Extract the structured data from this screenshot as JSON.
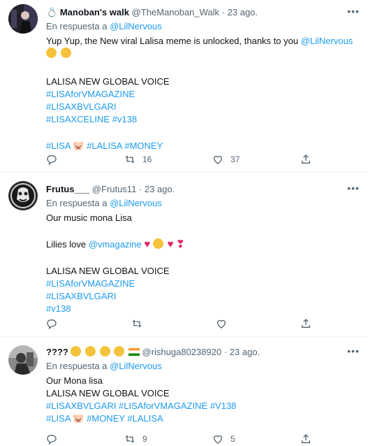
{
  "tweets": [
    {
      "name": "Manoban's walk",
      "handle": "@TheManoban_Walk",
      "time": "23 ago.",
      "reply_prefix": "En respuesta a",
      "reply_to": "@LilNervous",
      "text_main": "Yup Yup,  the New viral Lalisa meme is unlocked, thanks to you ",
      "text_mention": "@LilNervous",
      "line_voice": "LALISA NEW GLOBAL VOICE",
      "tags1": "#LISAforVMAGAZINE",
      "tags2": "#LISAXBVLGARI",
      "tags3": "#LISAXCELINE #v138",
      "tag_lisa": "#LISA",
      "tags_rest": "#LALISA #MONEY",
      "retweets": "16",
      "likes": "37"
    },
    {
      "name": "Frutus___",
      "handle": "@Frutus11",
      "time": "23 ago.",
      "reply_prefix": "En respuesta a",
      "reply_to": "@LilNervous",
      "line1": "Our music mona Lisa",
      "line2_prefix": "Lilies love ",
      "line2_mention": "@vmagazine",
      "line_voice": "LALISA NEW GLOBAL VOICE",
      "tags1": "#LISAforVMAGAZINE",
      "tags2": "#LISAXBVLGARI",
      "tags3": "#v138"
    },
    {
      "name": "????",
      "handle": "@rishuga80238920",
      "time": "23 ago.",
      "reply_prefix": "En respuesta a",
      "reply_to": "@LilNervous",
      "line1": "Our Mona lisa",
      "line_voice": "LALISA NEW GLOBAL VOICE",
      "tags1": "#LISAXBVLGARI  #LISAforVMAGAZINE  #V138",
      "tag_lisa": "#LISA",
      "tags_rest": "#MONEY #LALISA",
      "retweets": "9",
      "likes": "5"
    }
  ],
  "ui": {
    "dot": "·",
    "more": "•••"
  }
}
